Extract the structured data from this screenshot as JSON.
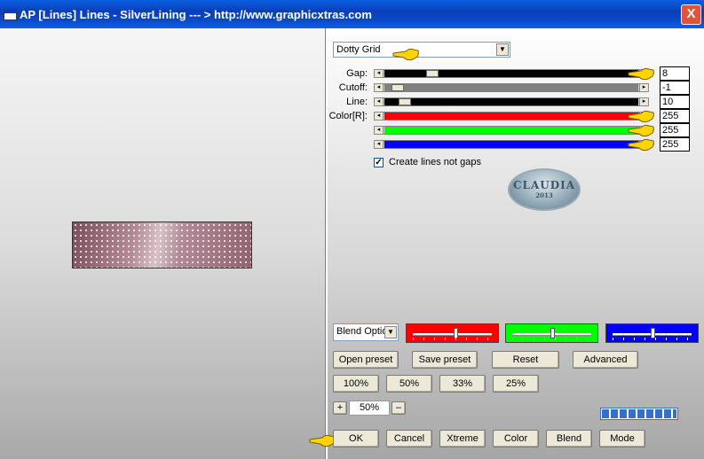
{
  "window": {
    "title": "AP [Lines]  Lines - SilverLining     --- > http://www.graphicxtras.com",
    "close_label": "X"
  },
  "controls": {
    "mode_select": "Dotty Grid",
    "sliders": [
      {
        "label": "Gap:",
        "value": "8",
        "fill": "#000000",
        "thumb_fraction": 0.17
      },
      {
        "label": "Cutoff:",
        "value": "-1",
        "fill": "#808080",
        "thumb_fraction": 0.03
      },
      {
        "label": "Line:",
        "value": "10",
        "fill": "#000000",
        "thumb_fraction": 0.06
      },
      {
        "label": "Color[R]:",
        "value": "255",
        "fill": "#ff0000",
        "thumb_fraction": 1.0
      },
      {
        "label": "",
        "value": "255",
        "fill": "#00ff00",
        "thumb_fraction": 1.0
      },
      {
        "label": "",
        "value": "255",
        "fill": "#0000ff",
        "thumb_fraction": 1.0
      }
    ],
    "checkbox_label": "Create lines not gaps",
    "checkbox_checked": true
  },
  "logo": {
    "text": "CLAUDIA",
    "subtext": "2013"
  },
  "blend": {
    "select": "Blend Optio",
    "colors": [
      {
        "color": "#ff0000",
        "thumb_fraction": 0.53
      },
      {
        "color": "#00ff00",
        "thumb_fraction": 0.5
      },
      {
        "color": "#0000ff",
        "thumb_fraction": 0.5
      }
    ]
  },
  "buttons": {
    "open_preset": "Open preset",
    "save_preset": "Save preset",
    "reset": "Reset",
    "advanced": "Advanced",
    "zoom100": "100%",
    "zoom50": "50%",
    "zoom33": "33%",
    "zoom25": "25%",
    "zoom_in": "+",
    "zoom_value": "50%",
    "zoom_out": "–",
    "ok": "OK",
    "cancel": "Cancel",
    "xtreme": "Xtreme",
    "color": "Color",
    "blend": "Blend",
    "mode": "Mode"
  },
  "progress": {
    "fraction": 1.0
  },
  "colors": {
    "pointer": "#ffd400",
    "titlebar": "#0a4fd0"
  }
}
